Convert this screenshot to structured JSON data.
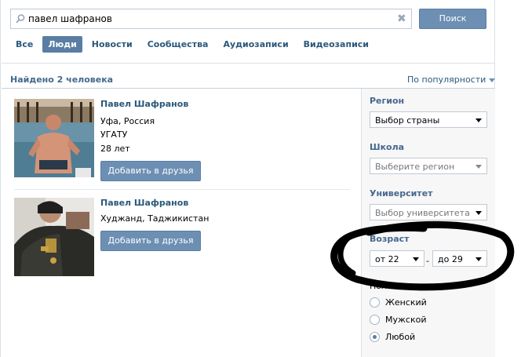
{
  "search": {
    "value": "павел шафранов",
    "button_label": "Поиск"
  },
  "tabs": [
    {
      "label": "Все",
      "active": false
    },
    {
      "label": "Люди",
      "active": true
    },
    {
      "label": "Новости",
      "active": false
    },
    {
      "label": "Сообщества",
      "active": false
    },
    {
      "label": "Аудиозаписи",
      "active": false
    },
    {
      "label": "Видеозаписи",
      "active": false
    }
  ],
  "results_header": {
    "found_text": "Найдено 2 человека",
    "sort_label": "По популярности"
  },
  "results": [
    {
      "name": "Павел Шафранов",
      "location": "Уфа, Россия",
      "university": "УГАТУ",
      "age": "28 лет",
      "add_label": "Добавить в друзья"
    },
    {
      "name": "Павел Шафранов",
      "location": "Худжанд, Таджикистан",
      "add_label": "Добавить в друзья"
    }
  ],
  "filters": {
    "region_label": "Регион",
    "region_value": "Выбор страны",
    "school_label": "Школа",
    "school_value": "Выберите регион",
    "university_label": "Университет",
    "university_value": "Выбор университета",
    "age_label": "Возраст",
    "age_from": "от 22",
    "age_separator": "-",
    "age_to": "до 29",
    "gender_label": "Пол",
    "gender_options": [
      {
        "label": "Женский",
        "checked": false
      },
      {
        "label": "Мужской",
        "checked": false
      },
      {
        "label": "Любой",
        "checked": true
      }
    ]
  },
  "colors": {
    "accent": "#597da3",
    "button": "#6d8fb3",
    "link": "#2b587a",
    "panel_bg": "#f7f7f7",
    "annotation_ink": "#000000"
  }
}
